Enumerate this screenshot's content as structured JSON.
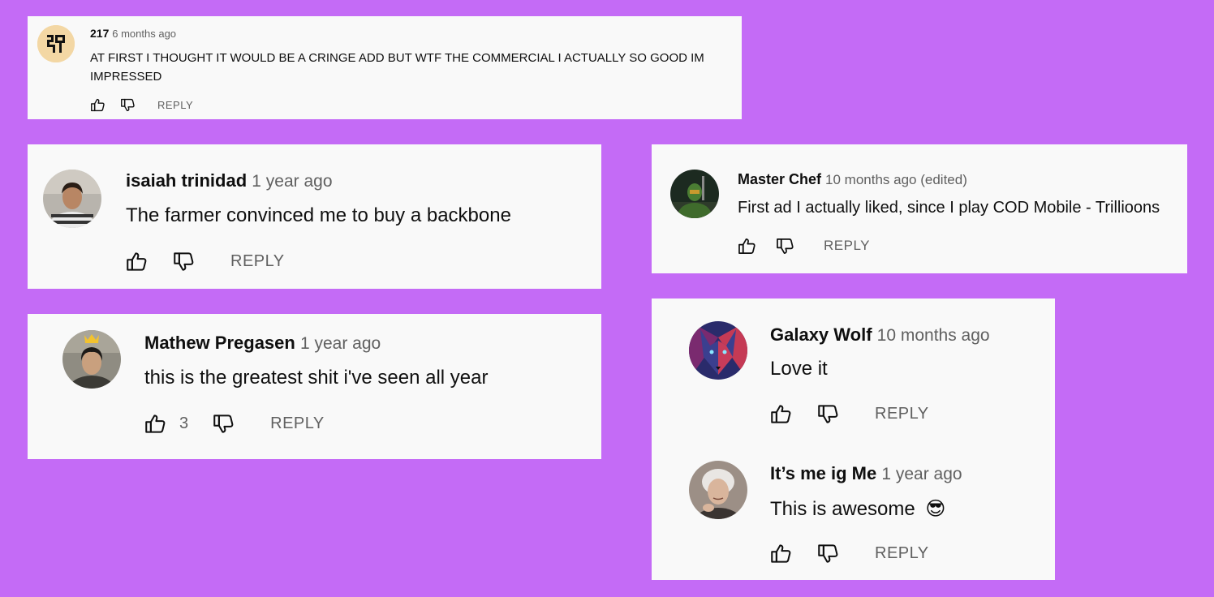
{
  "colors": {
    "background": "#c46bf6",
    "card": "#f9f9f9",
    "muted": "#606060"
  },
  "comments": [
    {
      "author": "217",
      "time": "6 months ago",
      "text_line1": "AT FIRST I THOUGHT IT WOULD BE A CRINGE ADD BUT WTF THE COMMERCIAL I ACTUALLY SO GOOD IM",
      "text_line2": "IMPRESSED",
      "reply": "REPLY",
      "avatar_icon": "pixel-logo-avatar"
    },
    {
      "author": "isaiah trinidad",
      "time": "1 year ago",
      "text": "The farmer convinced me to buy a backbone",
      "reply": "REPLY",
      "avatar_icon": "person-avatar"
    },
    {
      "author": "Mathew Pregasen",
      "time": "1 year ago",
      "text": "this is the greatest shit i've seen all year",
      "likes": "3",
      "reply": "REPLY",
      "avatar_icon": "person-with-crown-avatar"
    },
    {
      "author": "Master Chef",
      "time": "10 months ago (edited)",
      "text": "First ad I actually liked, since I play COD Mobile - Trillioons",
      "reply": "REPLY",
      "avatar_icon": "armored-soldier-avatar"
    },
    {
      "author": "Galaxy Wolf",
      "time": "10 months ago",
      "text": "Love it",
      "reply": "REPLY",
      "avatar_icon": "wolf-avatar"
    },
    {
      "author": "It’s me ig Me",
      "time": "1 year ago",
      "text": "This is awesome",
      "emoji": "😎",
      "reply": "REPLY",
      "avatar_icon": "elderly-woman-avatar"
    }
  ]
}
